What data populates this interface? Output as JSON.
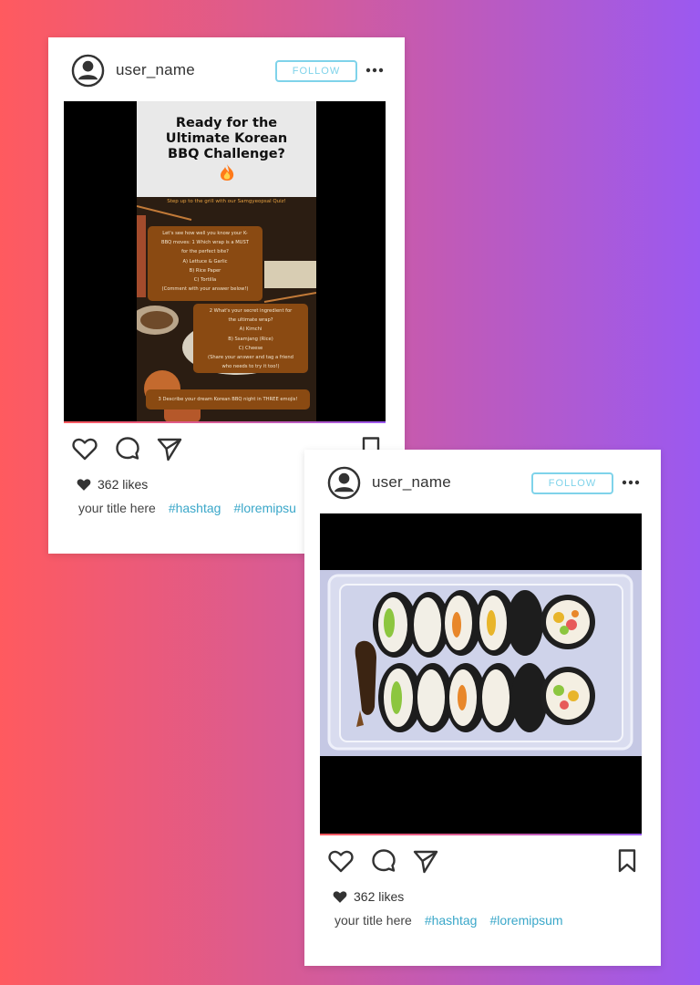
{
  "posts": [
    {
      "username": "user_name",
      "follow_label": "FOLLOW",
      "likes": "362 likes",
      "title": "your title here",
      "hashtags": [
        "#hashtag",
        "#loremipsu"
      ],
      "quiz": {
        "title_lines": [
          "Ready for the",
          "Ultimate Korean",
          "BBQ Challenge?"
        ],
        "subtitle": "Step up to the grill with our Samgyeopsal Quiz!",
        "q1": [
          "Let's see how well you know your K-",
          "BBQ moves: 1 Which wrap is a MUST",
          "for the perfect bite?",
          "A) Lettuce & Garlic",
          "B) Rice Paper",
          "C) Tortilla",
          "(Comment with your answer below!)"
        ],
        "q2": [
          "2 What's your secret ingredient for",
          "the ultimate wrap?",
          "A) Kimchi",
          "B) Ssamjang (Rice)",
          "C) Cheese",
          "(Share your answer and tag a friend",
          "who needs to try it too!)"
        ],
        "q3": "3 Describe your dream Korean BBQ night in THREE emojis!"
      }
    },
    {
      "username": "user_name",
      "follow_label": "FOLLOW",
      "likes": "362 likes",
      "title": "your title here",
      "hashtags": [
        "#hashtag",
        "#loremipsum"
      ]
    }
  ],
  "icons": [
    "avatar-icon",
    "more-icon",
    "heart-icon",
    "comment-icon",
    "share-icon",
    "bookmark-icon"
  ],
  "colors": {
    "follow": "#7fd3ea",
    "hashtag": "#3aa7c9",
    "quiz_box": "#8a4a12"
  }
}
